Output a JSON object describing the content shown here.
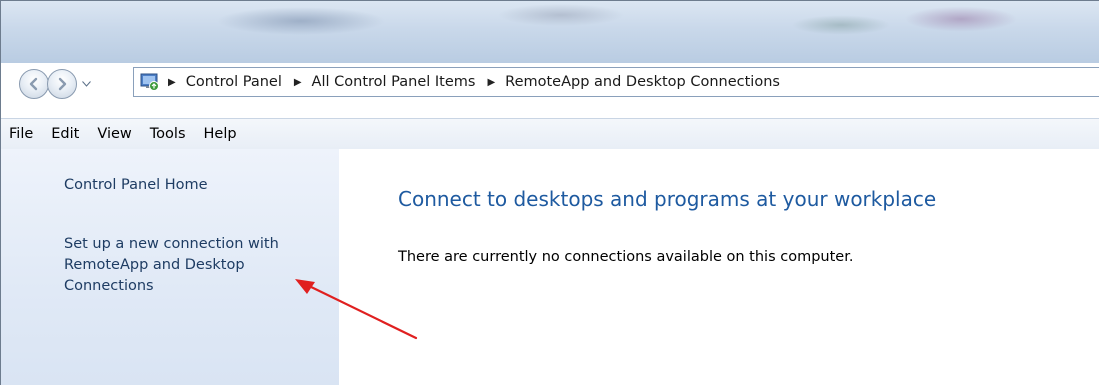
{
  "address_bar": {
    "crumbs": [
      "Control Panel",
      "All Control Panel Items",
      "RemoteApp and Desktop Connections"
    ]
  },
  "menu": {
    "items": [
      "File",
      "Edit",
      "View",
      "Tools",
      "Help"
    ]
  },
  "sidebar": {
    "home_link": "Control Panel Home",
    "setup_link": "Set up a new connection with RemoteApp and Desktop Connections"
  },
  "main": {
    "title": "Connect to desktops and programs at your workplace",
    "message": "There are currently no connections available on this computer."
  },
  "icons": {
    "back": "back-arrow-icon",
    "forward": "forward-arrow-icon",
    "recent": "chevron-down-icon",
    "location": "control-panel-icon",
    "breadcrumb_separator": "chevron-right-icon"
  },
  "colors": {
    "link": "#1e3c63",
    "title": "#1e5aa0",
    "sidebar": "#e3ebf6",
    "annotation": "#e02020"
  }
}
